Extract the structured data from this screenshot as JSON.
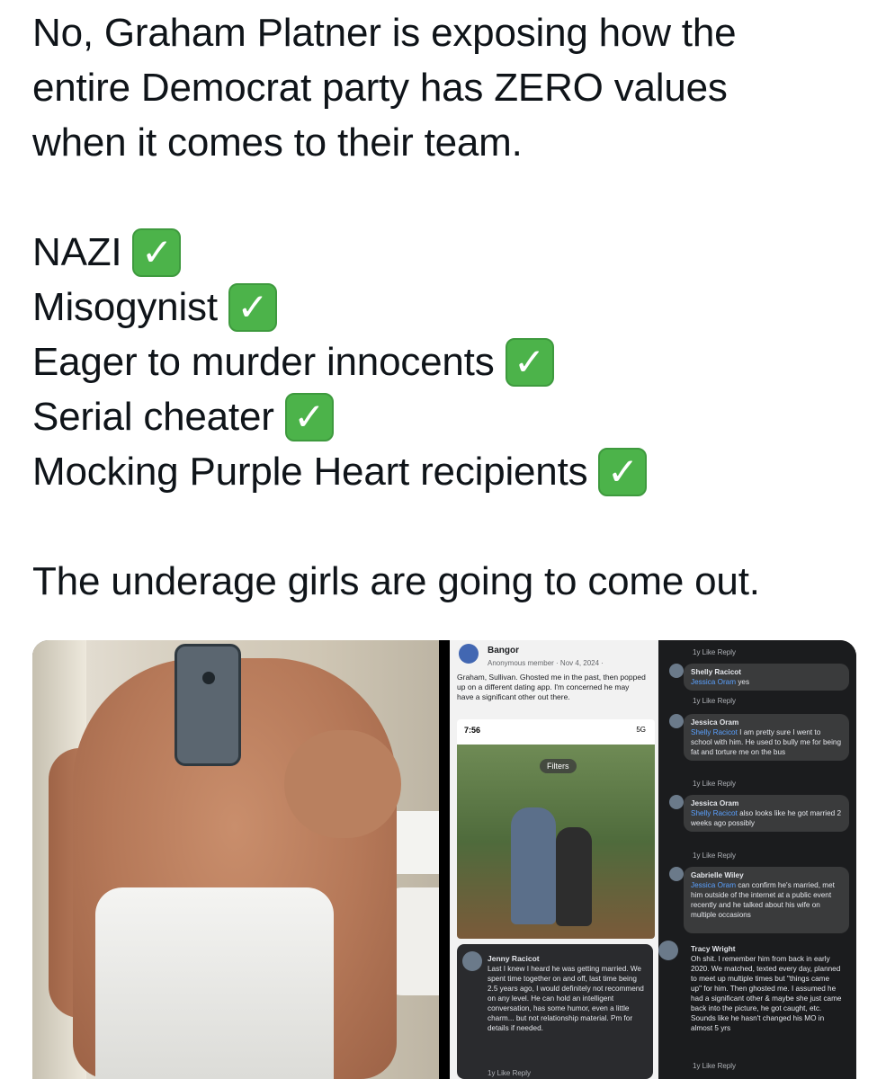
{
  "tweet": {
    "lines": [
      "No, Graham Platner is exposing how the",
      "entire Democrat party has ZERO values",
      "when it comes to their team.",
      "",
      "NAZI",
      "Misogynist",
      "Eager to murder innocents",
      "Serial cheater",
      "Mocking Purple Heart recipients",
      "",
      "The underage girls are going to come out."
    ],
    "check_glyph": "✓"
  },
  "screenshot": {
    "post": {
      "group": "Bangor",
      "sub": "Anonymous member · Nov 4, 2024 ·",
      "body": "Graham, Sullivan. Ghosted me in the past, then popped up on a different dating app. I'm concerned he may have a significant other out there.",
      "phone_time": "7:56",
      "phone_signal": "5G",
      "filters": "Filters"
    },
    "jenny": {
      "name": "Jenny Racicot",
      "body": "Last I knew I heard he was getting married. We spent time together on and off, last time being 2.5 years ago, I would definitely not recommend on any level. He can hold an intelligent conversation, has some humor, even a little charm... but not relationship material. Pm for details if needed.",
      "actions": "1y  Like  Reply"
    },
    "comments": [
      {
        "name": "Shelly Racicot",
        "mention": "Jessica Oram",
        "text": " yes",
        "meta": "1y  Like  Reply"
      },
      {
        "name": "Jessica Oram",
        "mention": "Shelly Racicot",
        "text": " I am pretty sure I went to school with him. He used to bully me for being fat and torture me on the bus",
        "meta": "1y  Like  Reply"
      },
      {
        "name": "Jessica Oram",
        "mention": "Shelly Racicot",
        "text": " also looks like he got married 2 weeks ago possibly",
        "meta": "1y  Like  Reply"
      },
      {
        "name": "Gabrielle Wiley",
        "mention": "Jessica Oram",
        "text": " can confirm he's married, met him outside of the internet at a public event recently and he talked about his wife on multiple occasions",
        "meta": ""
      },
      {
        "name": "Tracy Wright",
        "mention": "",
        "text": "Oh shit. I remember him from back in early 2020. We matched, texted every day, planned to meet up multiple times but \"things came up\" for him. Then ghosted me. I assumed he had a significant other & maybe she just came back into the picture, he got caught, etc. Sounds like he hasn't changed his MO in almost 5 yrs",
        "meta": "1y  Like  Reply"
      }
    ],
    "top_meta": "1y  Like  Reply"
  }
}
